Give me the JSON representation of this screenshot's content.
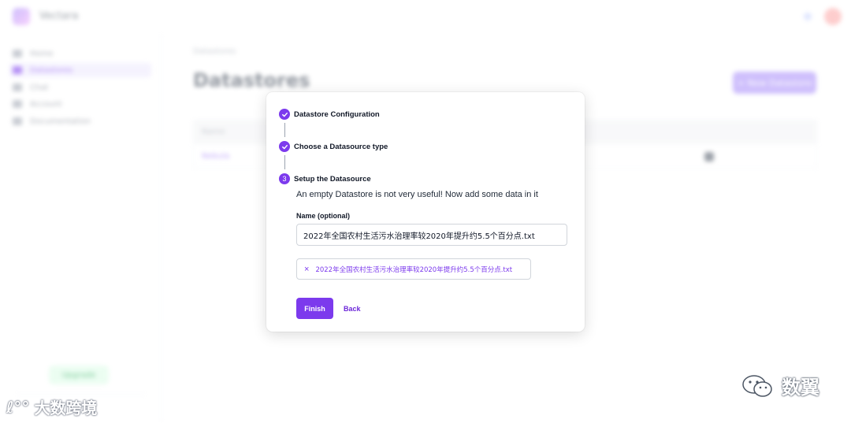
{
  "background": {
    "brand": "Vectara",
    "breadcrumb": "Datastores",
    "page_title": "Datastores",
    "primary_action": "+ New Datastore",
    "table_header": "Name",
    "table_row_link": "Nebula",
    "sidebar_items": [
      "Home",
      "Datastores",
      "Chat",
      "Account",
      "Documentation"
    ],
    "sidebar_active_index": 1,
    "sidebar_bottom_button": "Upgrade"
  },
  "modal": {
    "steps": [
      {
        "label": "Datastore Configuration",
        "state": "done"
      },
      {
        "label": "Choose a Datasource type",
        "state": "done"
      },
      {
        "label": "Setup the Datasource",
        "state": "active",
        "number": "3"
      }
    ],
    "description": "An empty Datastore is not very useful! Now add some data in it",
    "name_label": "Name (optional)",
    "name_value": "2022年全国农村生活污水治理率较2020年提升约5.5个百分点.txt",
    "file_chip": {
      "remove_icon": "×",
      "filename": "2022年全国农村生活污水治理率较2020年提升约5.5个百分点.txt"
    },
    "finish_label": "Finish",
    "back_label": "Back"
  },
  "watermarks": {
    "left_glyph": "ℓ°°",
    "left_text": "大数跨境",
    "right_text": "数翼"
  },
  "colors": {
    "accent": "#7c3aed",
    "accent_light": "#a78bfa"
  }
}
